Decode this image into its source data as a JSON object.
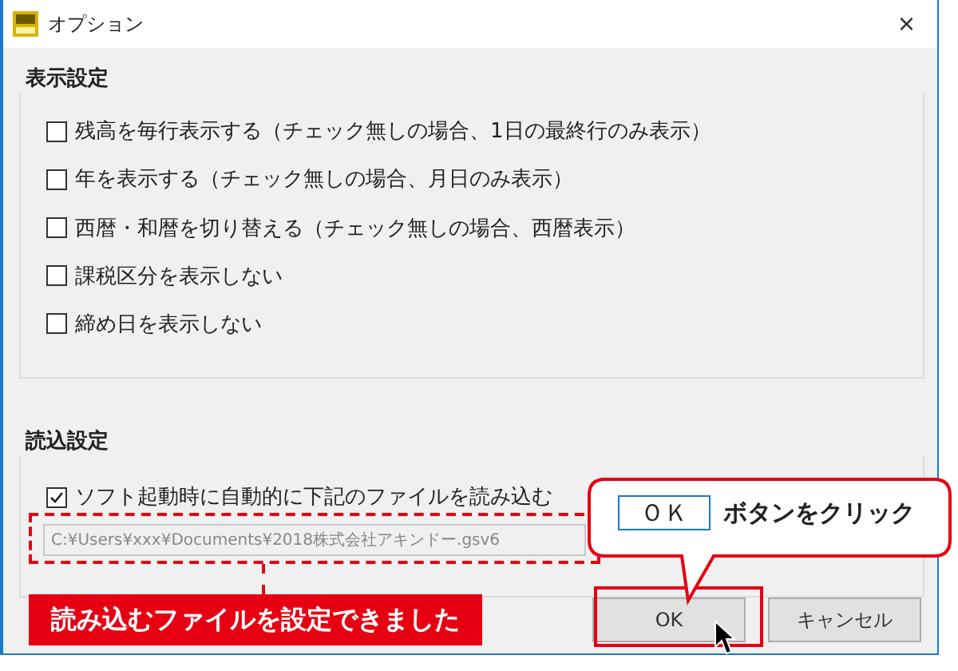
{
  "window": {
    "title": "オプション",
    "close": "×"
  },
  "display_settings": {
    "title": "表示設定",
    "options": [
      {
        "label": "残高を毎行表示する（チェック無しの場合、1日の最終行のみ表示）",
        "checked": false
      },
      {
        "label": "年を表示する（チェック無しの場合、月日のみ表示）",
        "checked": false
      },
      {
        "label": "西暦・和暦を切り替える（チェック無しの場合、西暦表示）",
        "checked": false
      },
      {
        "label": "課税区分を表示しない",
        "checked": false
      },
      {
        "label": "締め日を表示しない",
        "checked": false
      }
    ]
  },
  "load_settings": {
    "title": "読込設定",
    "option": {
      "label": "ソフト起動時に自動的に下記のファイルを読み込む",
      "checked": true
    },
    "file_path": "C:¥Users¥xxx¥Documents¥2018株式会社アキンドー.gsv6"
  },
  "buttons": [
    {
      "label": "OK"
    },
    {
      "label": "キャンセル"
    }
  ],
  "annotations": {
    "callout": {
      "key_label": "ＯＫ",
      "text": "ボタンをクリック"
    },
    "banner": "読み込むファイルを設定できました"
  }
}
